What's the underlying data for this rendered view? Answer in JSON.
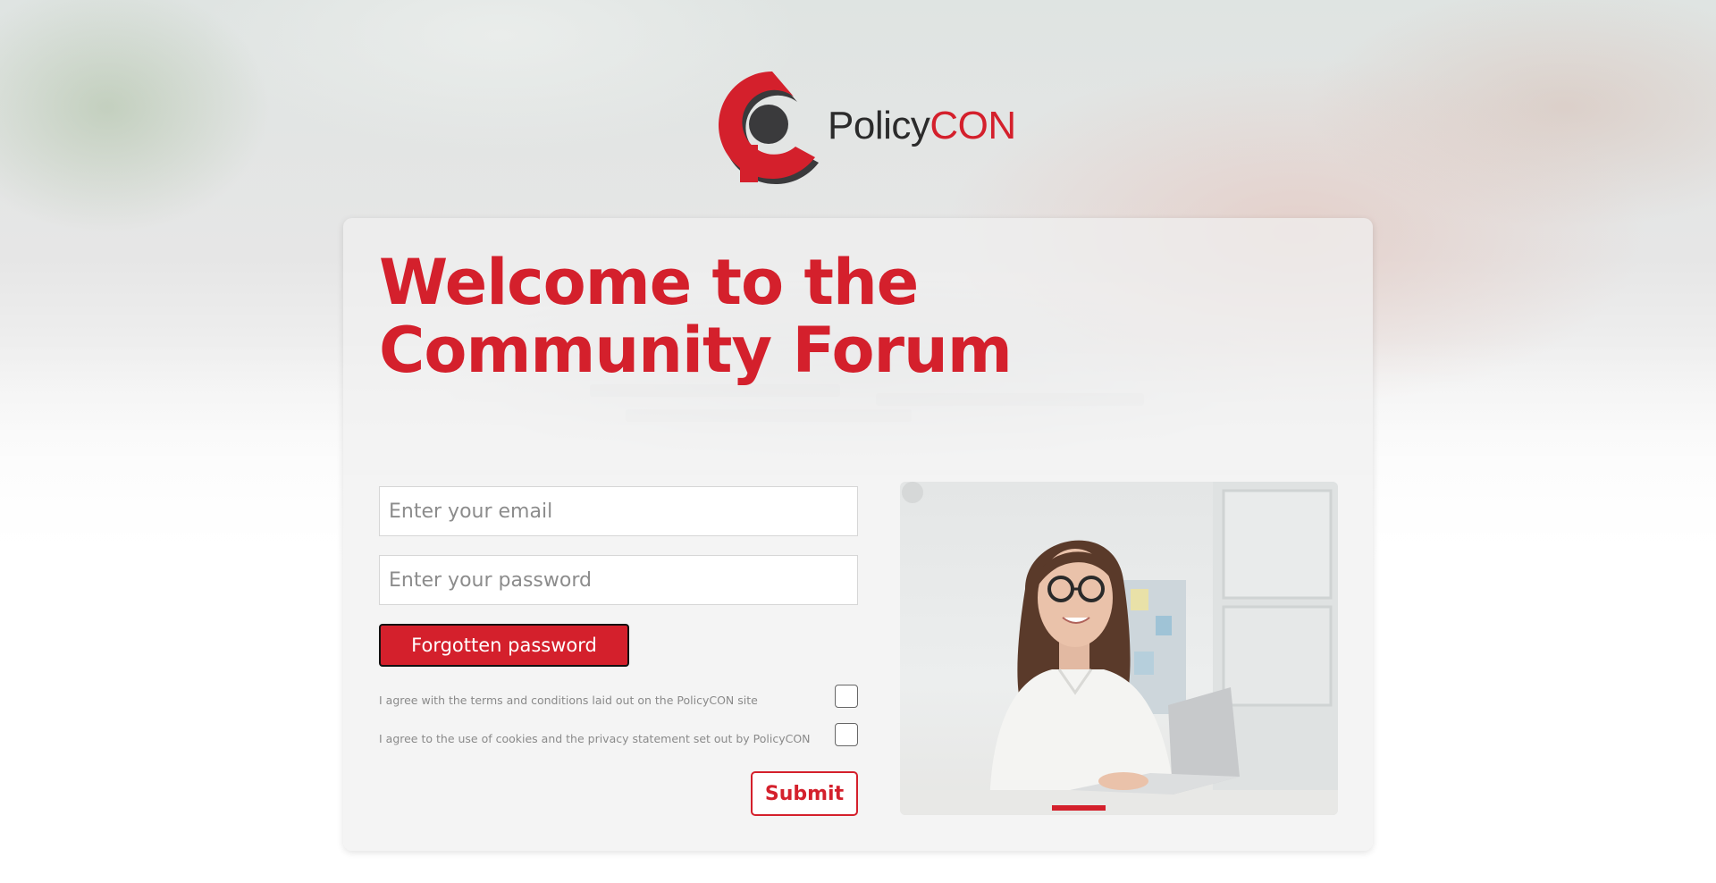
{
  "brand": {
    "logo_policy": "Policy",
    "logo_con": "CON",
    "colors": {
      "accent": "#d4202c",
      "logo_dark": "#3a3a3c",
      "text_dark": "#2b2b2b"
    }
  },
  "form": {
    "title": "Welcome to the Community Forum",
    "email_placeholder": "Enter your email",
    "password_placeholder": "Enter your password",
    "forgot_label": "Forgotten password",
    "terms_label": "I agree with the terms and conditions laid out on the PolicyCON site",
    "terms_checked": false,
    "cookies_label": "I agree to the use of cookies and the privacy statement set out by PolicyCON",
    "cookies_checked": false,
    "submit_label": "Submit"
  },
  "icons": {
    "logo": "policycon-logo-icon",
    "photo": "woman-at-laptop-photo"
  }
}
